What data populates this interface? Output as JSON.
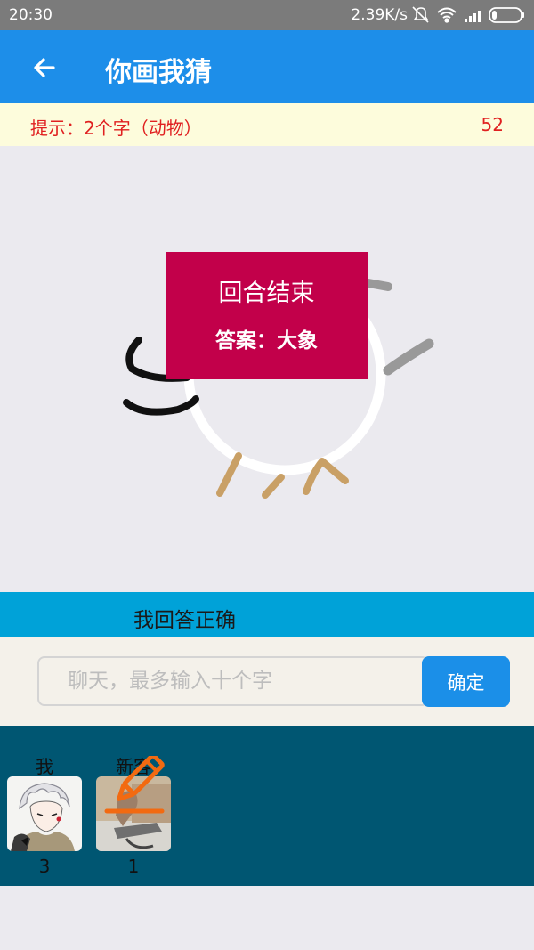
{
  "status_bar": {
    "time": "20:30",
    "net_speed": "2.39K/s",
    "icons": [
      "mute-bell-icon",
      "wifi-icon",
      "signal-icon",
      "battery-icon"
    ]
  },
  "header": {
    "title": "你画我猜",
    "back_icon": "back-arrow-icon"
  },
  "hint": {
    "text": "提示：2个字（动物）",
    "countdown": "52"
  },
  "round_dialog": {
    "title": "回合结束",
    "answer": "答案：大象"
  },
  "result": {
    "text": "我回答正确"
  },
  "chat": {
    "placeholder": "聊天，最多输入十个字",
    "value": "",
    "confirm_label": "确定"
  },
  "players": [
    {
      "name": "我",
      "score": "3",
      "is_drawing": false
    },
    {
      "name": "新客",
      "score": "1",
      "is_drawing": true
    }
  ],
  "colors": {
    "app_bar": "#1d8ee9",
    "hint_bg": "#fdfcdc",
    "hint_text": "#e02020",
    "dialog_bg": "#c2004a",
    "result_bar": "#00a2d8",
    "players_bg": "#005672",
    "confirm_button": "#1b8fe8",
    "pencil": "#f26a11"
  }
}
